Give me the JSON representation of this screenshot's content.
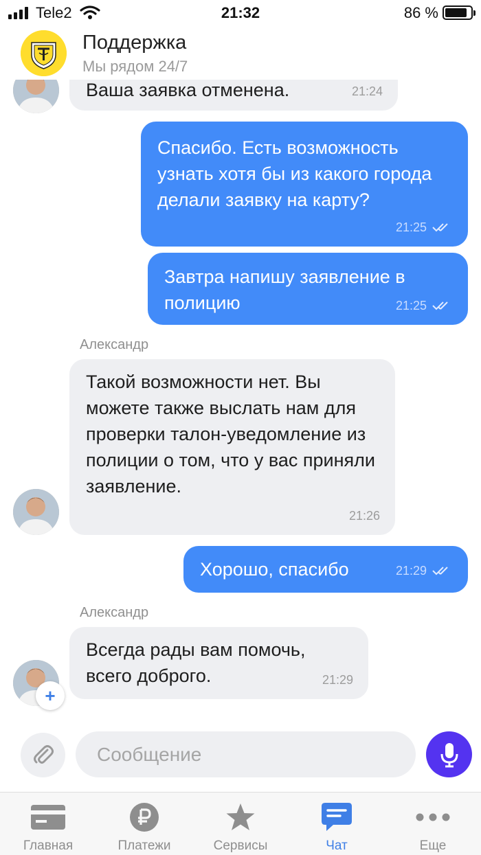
{
  "status_bar": {
    "carrier": "Tele2",
    "time": "21:32",
    "battery_percent": "86 %",
    "battery_level": 0.86
  },
  "header": {
    "title": "Поддержка",
    "subtitle": "Мы рядом 24/7"
  },
  "messages": [
    {
      "direction": "in",
      "text": "Ваша заявка отменена.",
      "time": "21:24"
    },
    {
      "direction": "out",
      "text": "Спасибо. Есть возможность узнать хотя бы из какого города делали заявку на карту?",
      "time": "21:25",
      "read": true
    },
    {
      "direction": "out",
      "text": "Завтра напишу заявление в полицию",
      "time": "21:25",
      "read": true
    },
    {
      "direction": "in",
      "sender": "Александр",
      "text": "Такой возможности нет. Вы можете также выслать нам для проверки талон-уведомление из полиции о том, что у вас приняли заявление.",
      "time": "21:26"
    },
    {
      "direction": "out",
      "text": "Хорошо, спасибо",
      "time": "21:29",
      "read": true
    },
    {
      "direction": "in",
      "sender": "Александр",
      "text": "Всегда рады вам помочь, всего доброго.",
      "time": "21:29"
    }
  ],
  "composer": {
    "placeholder": "Сообщение"
  },
  "tabs": [
    {
      "label": "Главная",
      "icon": "card-icon"
    },
    {
      "label": "Платежи",
      "icon": "ruble-icon"
    },
    {
      "label": "Сервисы",
      "icon": "star-icon"
    },
    {
      "label": "Чат",
      "icon": "chat-icon",
      "active": true
    },
    {
      "label": "Еще",
      "icon": "more-icon"
    }
  ],
  "colors": {
    "outgoing_bubble": "#428bf9",
    "incoming_bubble": "#eeeff2",
    "accent": "#3f7fe6",
    "mic_button": "#5433f0",
    "brand_yellow": "#ffdd2d"
  }
}
